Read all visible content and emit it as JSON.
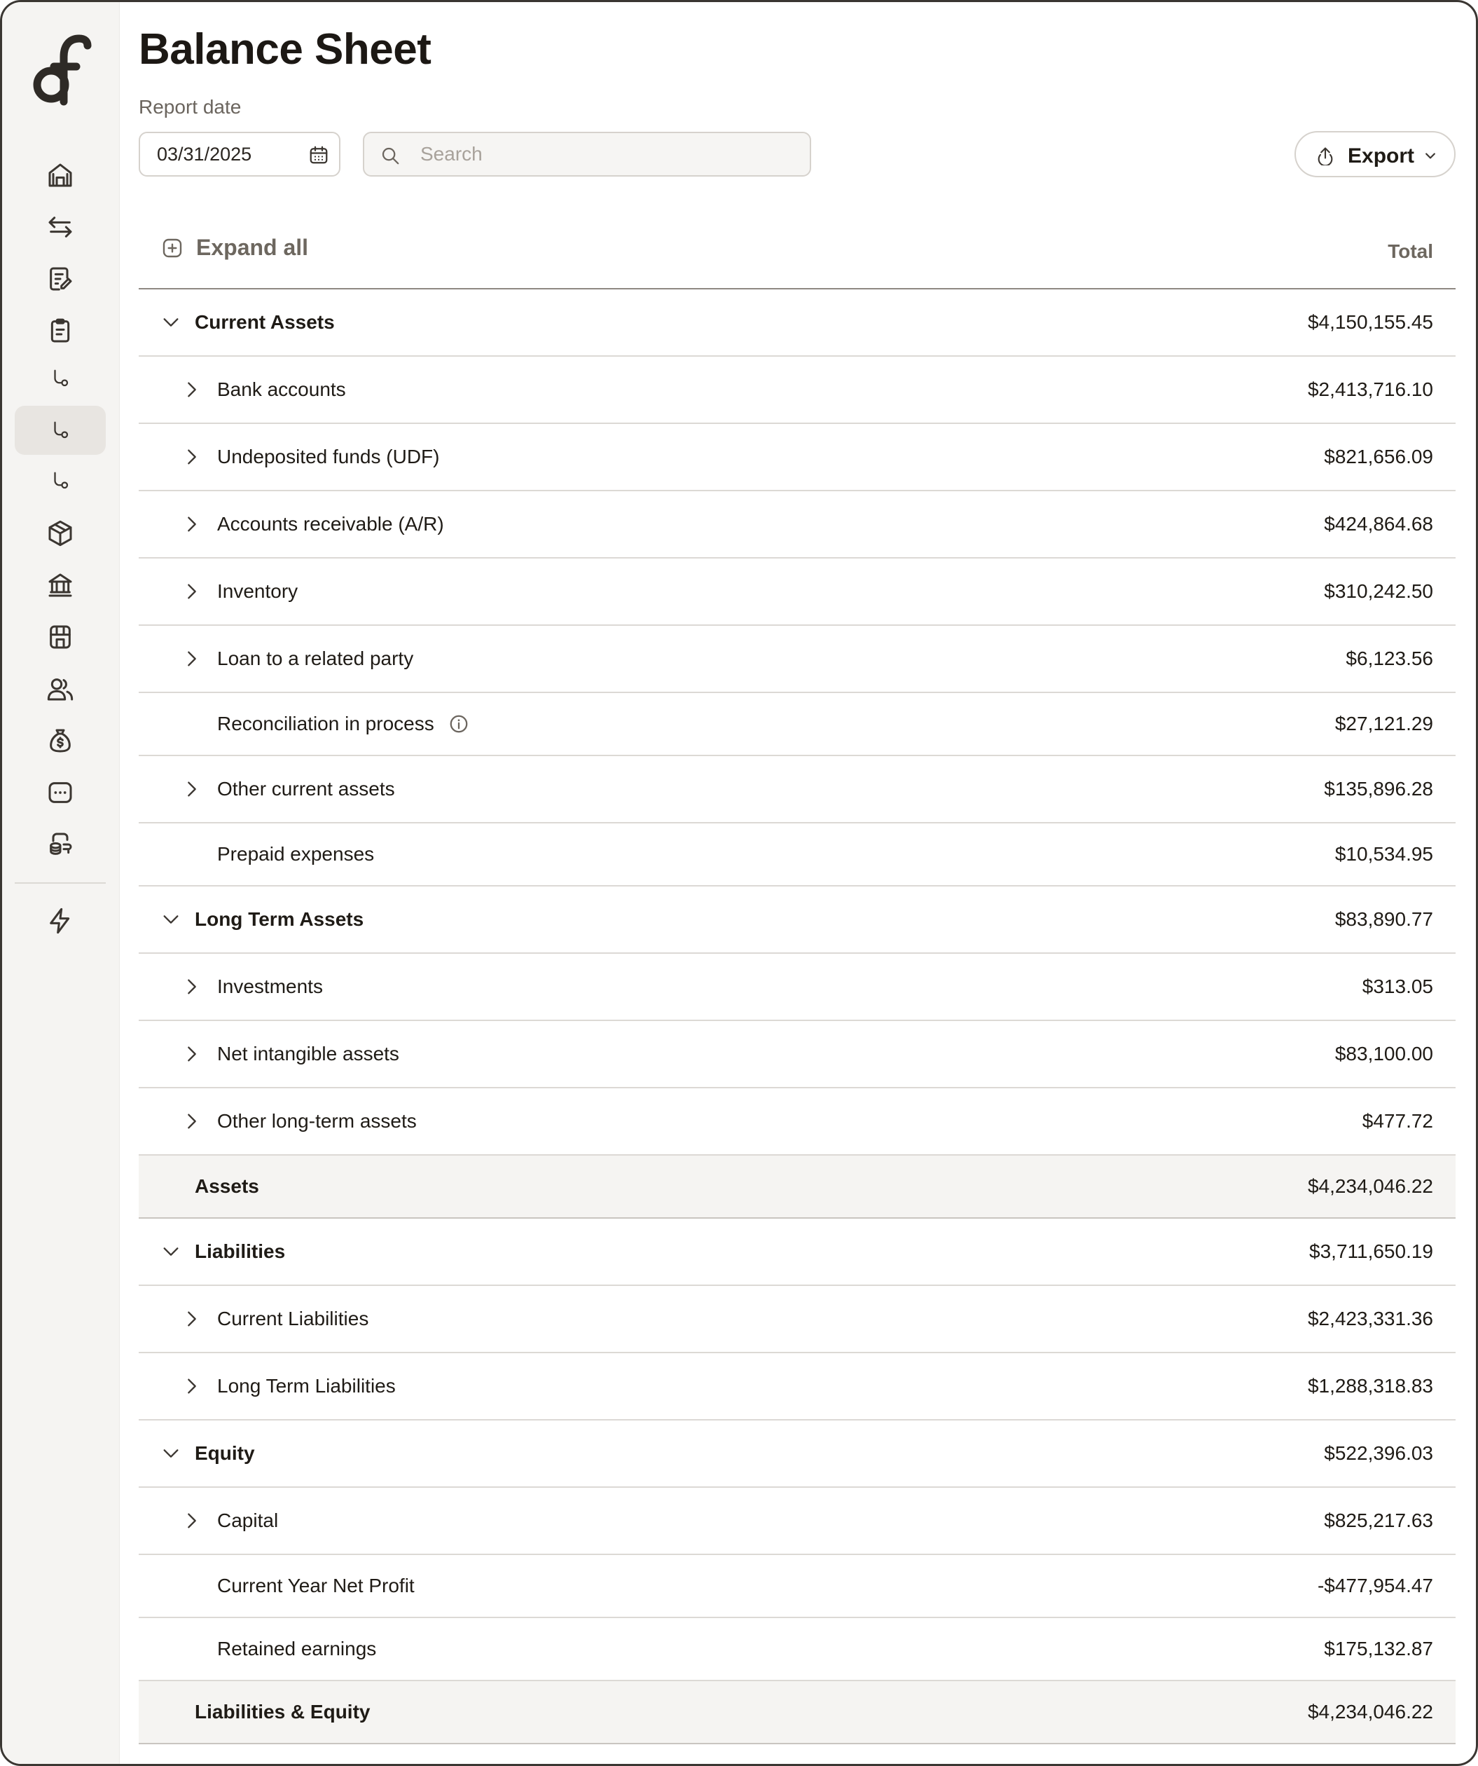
{
  "page": {
    "title": "Balance Sheet"
  },
  "filters": {
    "report_date_label": "Report date",
    "report_date": "03/31/2025",
    "search_placeholder": "Search",
    "export_label": "Export"
  },
  "sidebar": {
    "items": [
      {
        "icon": "home-icon"
      },
      {
        "icon": "transfer-arrows-icon"
      },
      {
        "icon": "invoice-edit-icon"
      },
      {
        "icon": "clipboard-icon"
      },
      {
        "icon": "sub-branch-icon"
      },
      {
        "icon": "sub-branch-icon",
        "active": true
      },
      {
        "icon": "sub-branch-icon"
      },
      {
        "icon": "package-icon"
      },
      {
        "icon": "bank-icon"
      },
      {
        "icon": "storefront-icon"
      },
      {
        "icon": "people-icon"
      },
      {
        "icon": "money-bag-icon"
      },
      {
        "icon": "more-chat-icon"
      },
      {
        "icon": "coins-hand-icon"
      },
      {
        "icon": "lightning-icon"
      }
    ]
  },
  "table": {
    "expand_all_label": "Expand all",
    "total_header": "Total",
    "rows": [
      {
        "label": "Current Assets",
        "amount": "$4,150,155.45"
      },
      {
        "label": "Bank accounts",
        "amount": "$2,413,716.10"
      },
      {
        "label": "Undeposited funds (UDF)",
        "amount": "$821,656.09"
      },
      {
        "label": "Accounts receivable (A/R)",
        "amount": "$424,864.68"
      },
      {
        "label": "Inventory",
        "amount": "$310,242.50"
      },
      {
        "label": "Loan to a related party",
        "amount": "$6,123.56"
      },
      {
        "label": "Reconciliation in process",
        "amount": "$27,121.29"
      },
      {
        "label": "Other current assets",
        "amount": "$135,896.28"
      },
      {
        "label": "Prepaid expenses",
        "amount": "$10,534.95"
      },
      {
        "label": "Long Term Assets",
        "amount": "$83,890.77"
      },
      {
        "label": "Investments",
        "amount": "$313.05"
      },
      {
        "label": "Net intangible assets",
        "amount": "$83,100.00"
      },
      {
        "label": "Other long-term assets",
        "amount": "$477.72"
      },
      {
        "label": "Assets",
        "amount": "$4,234,046.22"
      },
      {
        "label": "Liabilities",
        "amount": "$3,711,650.19"
      },
      {
        "label": "Current Liabilities",
        "amount": "$2,423,331.36"
      },
      {
        "label": "Long Term Liabilities",
        "amount": "$1,288,318.83"
      },
      {
        "label": "Equity",
        "amount": "$522,396.03"
      },
      {
        "label": "Capital",
        "amount": "$825,217.63"
      },
      {
        "label": "Current Year Net Profit",
        "amount": "-$477,954.47"
      },
      {
        "label": "Retained earnings",
        "amount": "$175,132.87"
      },
      {
        "label": "Liabilities & Equity",
        "amount": "$4,234,046.22"
      }
    ]
  }
}
